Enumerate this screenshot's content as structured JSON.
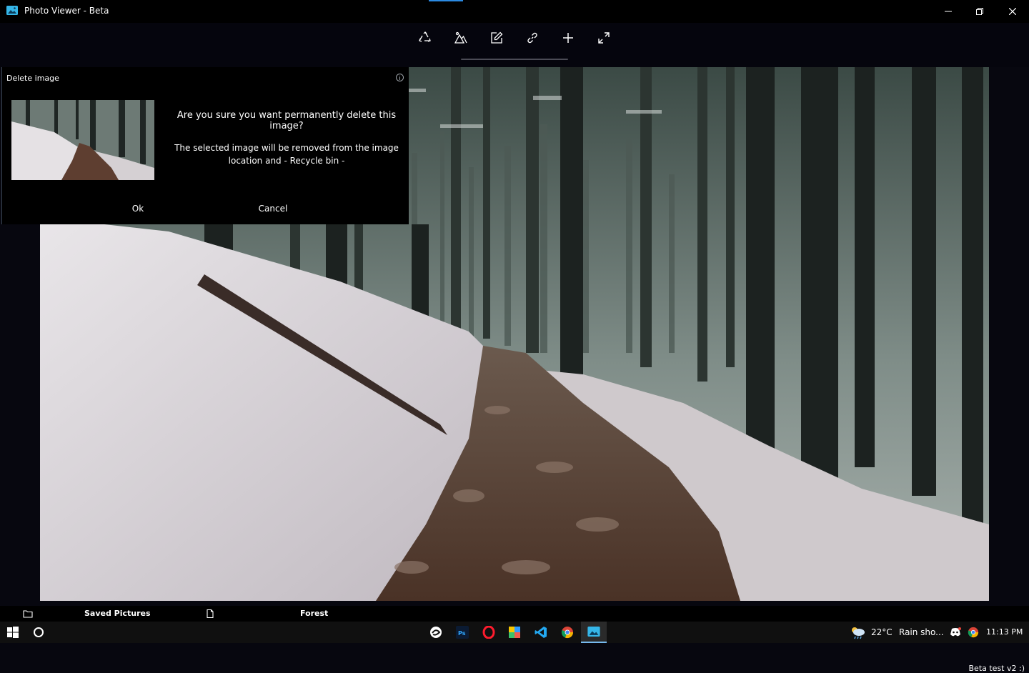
{
  "window": {
    "title": "Photo Viewer - Beta",
    "accent_color": "#2b8ae2",
    "controls": {
      "minimize_icon": "minimize-icon",
      "maximize_icon": "restore-icon",
      "close_icon": "close-icon"
    }
  },
  "toolbar": {
    "tools": [
      {
        "name": "recycle-icon"
      },
      {
        "name": "image-mountain-icon"
      },
      {
        "name": "edit-icon"
      },
      {
        "name": "link-icon"
      },
      {
        "name": "add-icon"
      },
      {
        "name": "fullscreen-icon"
      }
    ]
  },
  "dialog": {
    "title": "Delete image",
    "info_icon": "info-icon",
    "question": "Are you sure you want permanently delete this image?",
    "detail_line1": "The selected image will be removed from the image",
    "detail_line2": "location and - Recycle bin -",
    "ok_label": "Ok",
    "cancel_label": "Cancel"
  },
  "viewer": {
    "version_label": "Beta test v2 :)"
  },
  "bottom_bar": {
    "folder_icon": "folder-icon",
    "folder_label": "Saved Pictures",
    "file_icon": "file-icon",
    "file_label": "Forest"
  },
  "taskbar": {
    "apps": [
      "windows-start-icon",
      "cortana-icon",
      "wacom-icon",
      "photoshop-icon",
      "opera-icon",
      "sticky-app-icon",
      "vscode-icon",
      "chrome-icon",
      "photo-viewer-icon"
    ],
    "weather_temp": "22°C",
    "weather_text": "Rain sho...",
    "clock": "11:13 PM"
  }
}
